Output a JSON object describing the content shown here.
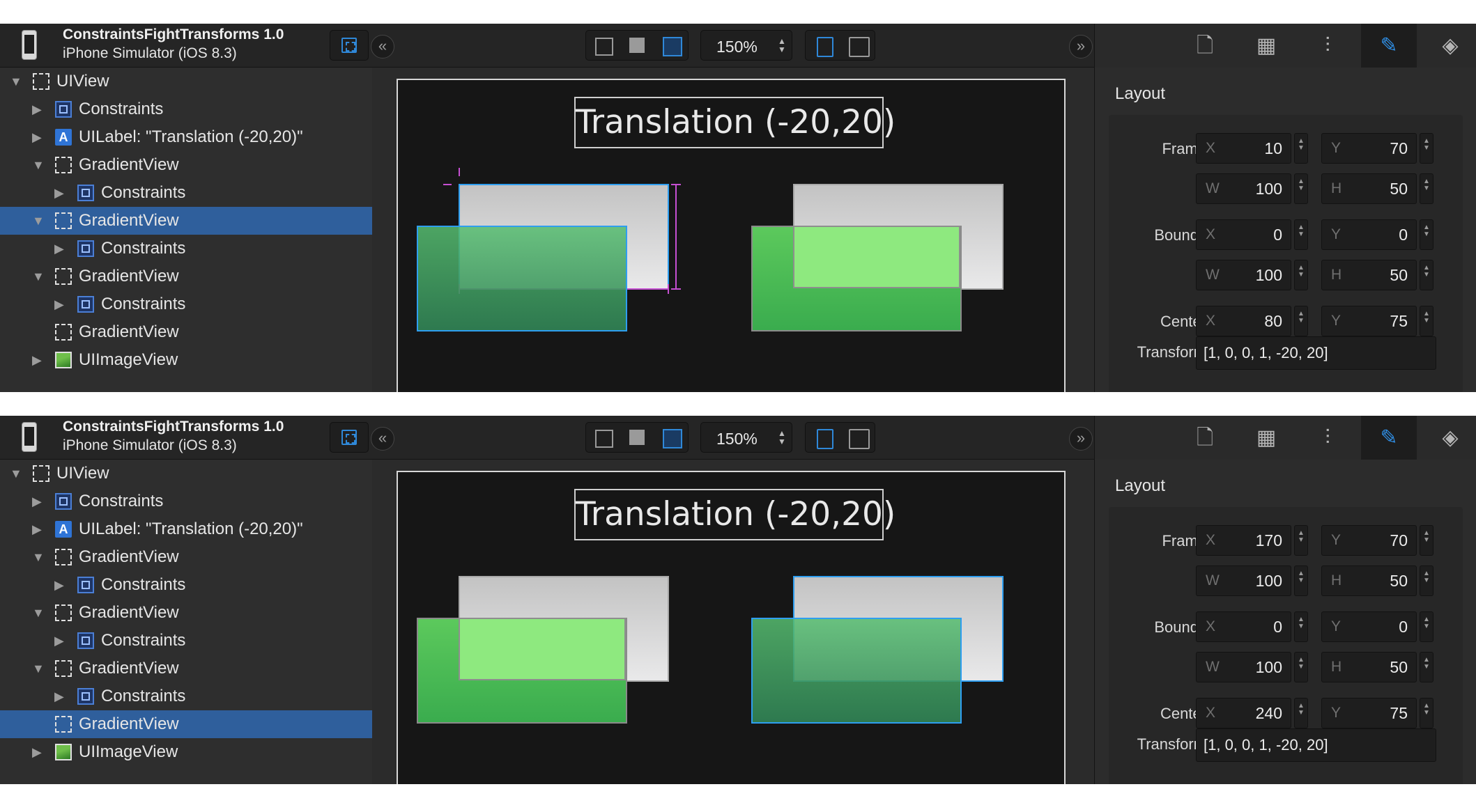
{
  "app": {
    "name": "ConstraintsFightTransforms 1.0",
    "subtitle": "iPhone Simulator (iOS 8.3)"
  },
  "toolbar": {
    "zoom": "150%",
    "collapse_left": "«",
    "collapse_right": "»",
    "zoom_arrows": "▲\n▼"
  },
  "inspector_tabs": [
    "file-icon",
    "table-icon",
    "sliders-icon",
    "ruler-icon",
    "layers-icon"
  ],
  "tree_labels": {
    "uiview": "UIView",
    "constraints": "Constraints",
    "uilabel": "UILabel: \"Translation (-20,20)\"",
    "gradientview": "GradientView",
    "uiimageview": "UIImageView",
    "label_icon_glyph": "A"
  },
  "canvas": {
    "title": "Translation (-20,20)"
  },
  "inspector": {
    "section": "Layout",
    "labels": {
      "frame": "Frame",
      "bounds": "Bounds",
      "center": "Center",
      "transform": "Transform"
    },
    "prefix": {
      "x": "X",
      "y": "Y",
      "w": "W",
      "h": "H"
    },
    "stepper": "▲\n▼"
  },
  "panels": [
    {
      "selected_row": 5,
      "frame": {
        "x": "10",
        "y": "70",
        "w": "100",
        "h": "50"
      },
      "bounds": {
        "x": "0",
        "y": "0",
        "w": "100",
        "h": "50"
      },
      "center": {
        "x": "80",
        "y": "75"
      },
      "transform": "[1, 0, 0, 1, -20, 20]"
    },
    {
      "selected_row": 9,
      "frame": {
        "x": "170",
        "y": "70",
        "w": "100",
        "h": "50"
      },
      "bounds": {
        "x": "0",
        "y": "0",
        "w": "100",
        "h": "50"
      },
      "center": {
        "x": "240",
        "y": "75"
      },
      "transform": "[1, 0, 0, 1, -20, 20]"
    }
  ],
  "colors": {
    "accent": "#2f88d8",
    "selection": "#2f5f9c",
    "guide": "#c64fd2",
    "green": "#4cbb55"
  }
}
